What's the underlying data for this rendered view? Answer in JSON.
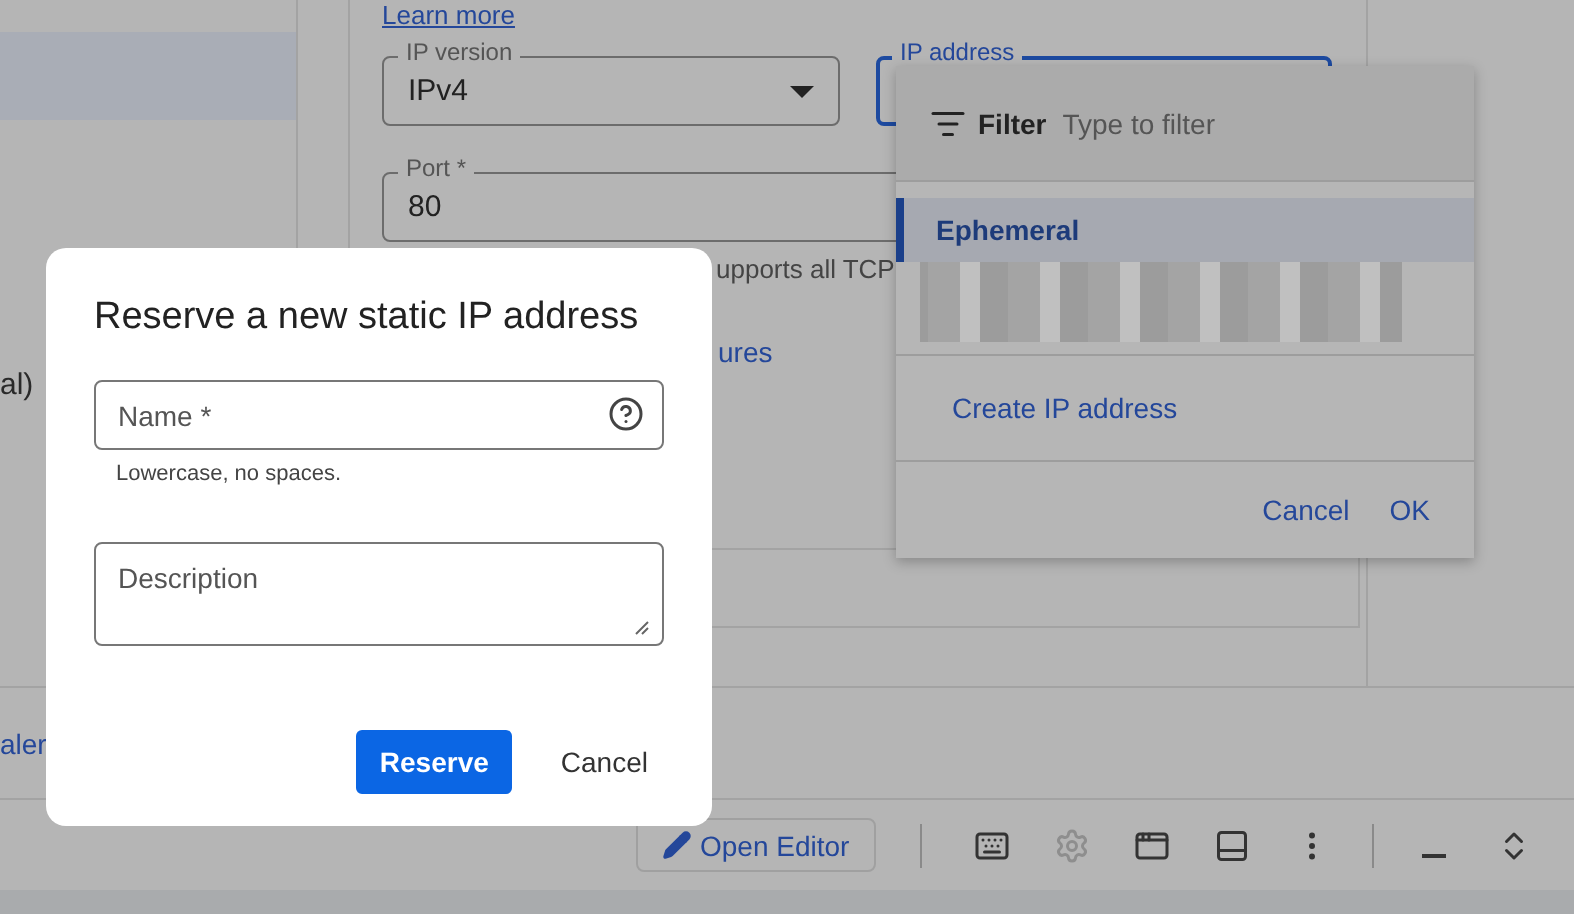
{
  "sidebar": {
    "items": [
      {
        "selected": true
      },
      {
        "label": "al)",
        "selected": false
      }
    ]
  },
  "content": {
    "learn_more": "Learn more",
    "ip_version": {
      "label": "IP version",
      "value": "IPv4"
    },
    "ip_address": {
      "label": "IP address"
    },
    "port": {
      "label": "Port *",
      "value": "80",
      "helper": "upports all TCP"
    },
    "link": "ures"
  },
  "section_link": "aler",
  "toolbar": {
    "open_editor": "Open Editor",
    "icons": [
      {
        "kind": "keyboard",
        "disabled": false
      },
      {
        "kind": "settings",
        "disabled": true
      },
      {
        "kind": "preview",
        "disabled": false
      },
      {
        "kind": "panel",
        "disabled": false
      },
      {
        "kind": "more",
        "disabled": false
      },
      {
        "kind": "minimize",
        "disabled": false
      },
      {
        "kind": "expand",
        "disabled": false
      }
    ]
  },
  "dropdown": {
    "filter_label": "Filter",
    "placeholder": "Type to filter",
    "options": [
      {
        "kind": "text",
        "label": "Ephemeral",
        "selected": true
      },
      {
        "kind": "redacted",
        "selected": false
      }
    ],
    "create": "Create IP address",
    "buttons": [
      "Cancel",
      "OK"
    ]
  },
  "dialog": {
    "title": "Reserve a new static IP address",
    "fields": [
      {
        "kind": "input",
        "placeholder": "Name *",
        "helper": "Lowercase, no spaces."
      },
      {
        "kind": "textarea",
        "placeholder": "Description"
      }
    ],
    "buttons": [
      {
        "label": "Reserve",
        "primary": true
      },
      {
        "label": "Cancel",
        "primary": false
      }
    ]
  }
}
